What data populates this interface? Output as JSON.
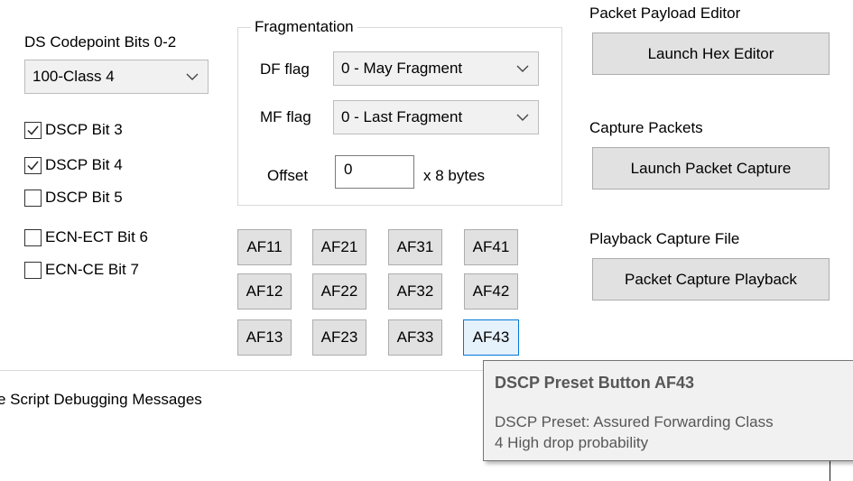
{
  "ds_codepoint": {
    "label": "DS Codepoint Bits 0-2",
    "selected": "100-Class 4"
  },
  "dscp_bits": [
    {
      "label": "DSCP Bit 3",
      "checked": true
    },
    {
      "label": "DSCP Bit 4",
      "checked": true
    },
    {
      "label": "DSCP Bit 5",
      "checked": false
    },
    {
      "label": "ECN-ECT Bit 6",
      "checked": false
    },
    {
      "label": "ECN-CE Bit 7",
      "checked": false
    }
  ],
  "fragmentation": {
    "title": "Fragmentation",
    "df_label": "DF flag",
    "df_value": "0 - May Fragment",
    "mf_label": "MF flag",
    "mf_value": "0 - Last Fragment",
    "offset_label": "Offset",
    "offset_value": "0",
    "offset_unit": "x 8 bytes"
  },
  "presets": [
    "AF11",
    "AF21",
    "AF31",
    "AF41",
    "AF12",
    "AF22",
    "AF32",
    "AF42",
    "AF13",
    "AF23",
    "AF33",
    "AF43"
  ],
  "right_panel": {
    "payload_label": "Packet Payload Editor",
    "payload_button": "Launch Hex Editor",
    "capture_label": "Capture Packets",
    "capture_button": "Launch Packet Capture",
    "playback_label": "Playback Capture File",
    "playback_button": "Packet Capture Playback"
  },
  "debug_label": "e Script Debugging Messages",
  "tooltip": {
    "title": "DSCP Preset Button AF43",
    "line1": "DSCP Preset: Assured Forwarding Class",
    "line2": "4 High drop probability"
  },
  "colors": {
    "focus_border": "#0078d7",
    "button_face": "#e1e1e1",
    "tooltip_bg": "#f1f1f1"
  }
}
